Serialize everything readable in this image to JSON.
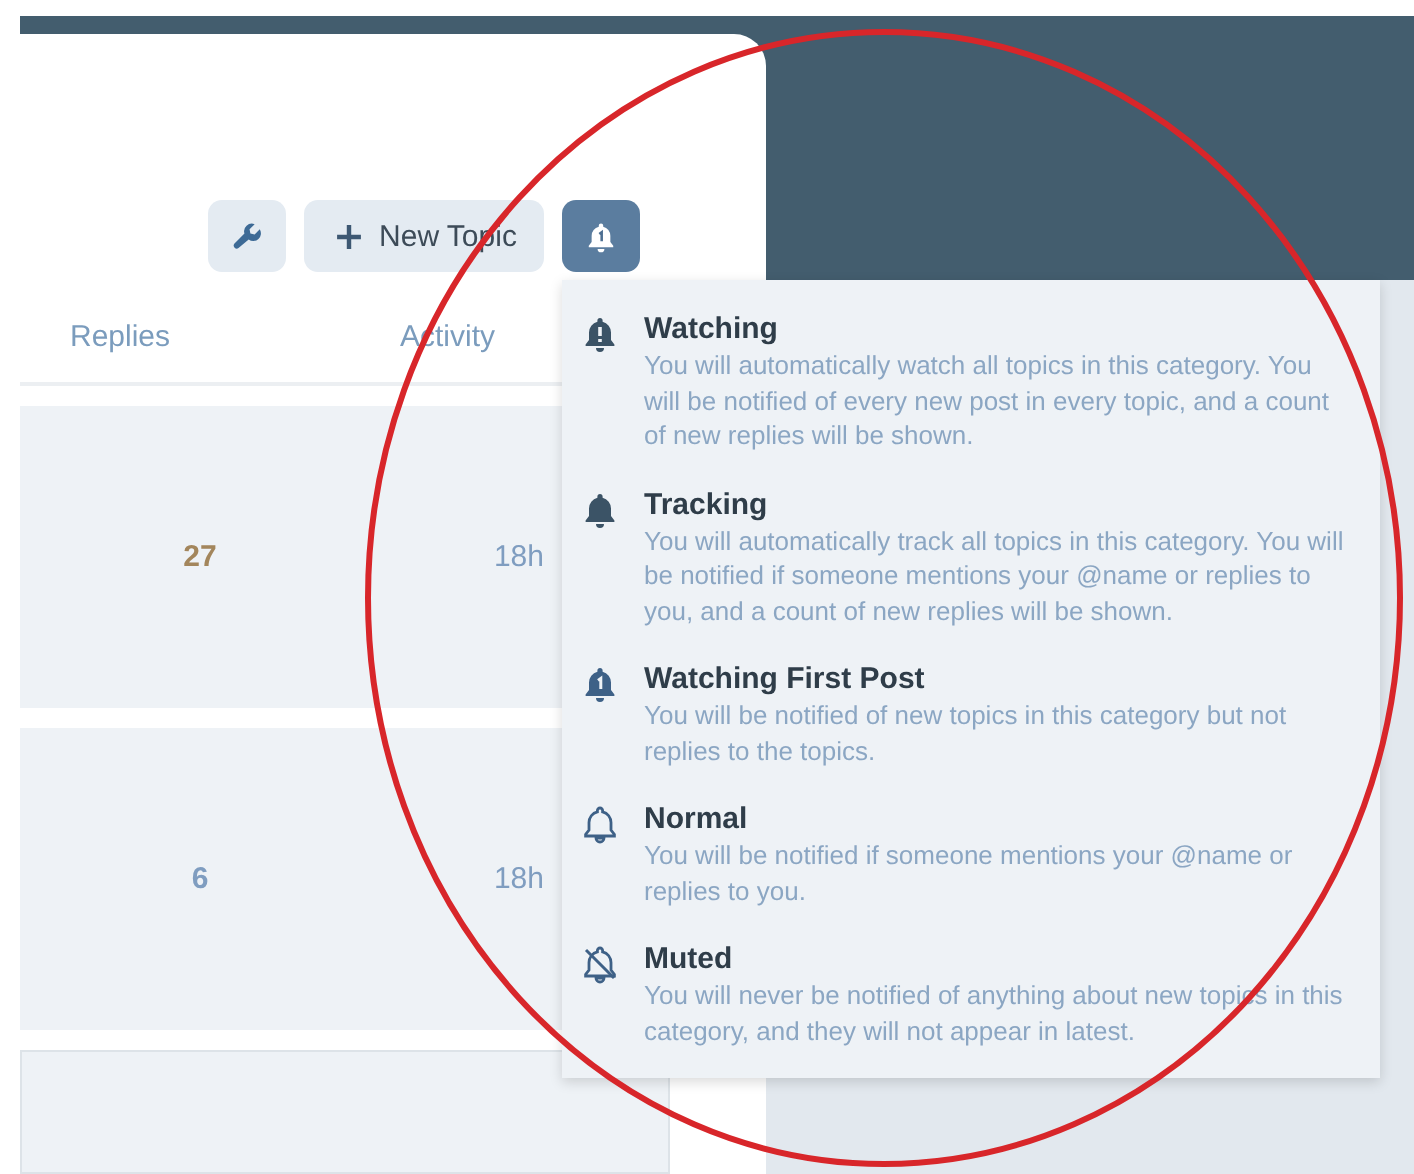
{
  "toolbar": [
    {
      "kind": "wrench",
      "selected": false
    },
    {
      "kind": "new",
      "label": "New Topic",
      "selected": false
    },
    {
      "kind": "bell",
      "selected": true
    }
  ],
  "table": {
    "columns": [
      "Replies",
      "Activity"
    ],
    "rows": [
      {
        "replies": "27",
        "color": "#a3865c",
        "activity": "18h"
      },
      {
        "replies": "6",
        "color": "#7f9dc0",
        "activity": "18h"
      }
    ]
  },
  "notification_menu": [
    {
      "kind": "watching",
      "title": "Watching",
      "description": "You will automatically watch all topics in this category. You will be notified of every new post in every topic, and a count of new replies will be shown."
    },
    {
      "kind": "tracking",
      "title": "Tracking",
      "description": "You will automatically track all topics in this category. You will be notified if someone mentions your @name or replies to you, and a count of new replies will be shown."
    },
    {
      "kind": "watching_first",
      "title": "Watching First Post",
      "description": "You will be notified of new topics in this category but not replies to the topics."
    },
    {
      "kind": "regular",
      "title": "Normal",
      "description": "You will be notified if someone mentions your @name or replies to you."
    },
    {
      "kind": "muted",
      "title": "Muted",
      "description": "You will never be notified of anything about new topics in this category, and they will not appear in latest."
    }
  ],
  "annotation_ellipse": true
}
